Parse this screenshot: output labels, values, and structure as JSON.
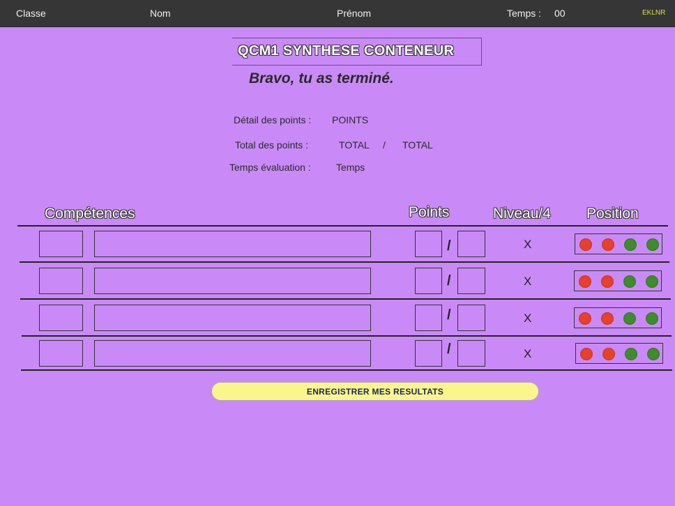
{
  "topbar": {
    "classe_label": "Classe",
    "nom_label": "Nom",
    "prenom_label": "Prénom",
    "temps_label": "Temps :",
    "temps_value": "00",
    "brand": "EKLNR"
  },
  "header": {
    "title": "QCM1 SYNTHESE CONTENEUR",
    "message": "Bravo, tu as terminé."
  },
  "summary": {
    "detail_label": "Détail des points :",
    "detail_value": "POINTS",
    "total_label": "Total des points :",
    "total_value": "TOTAL",
    "total_separator": "/",
    "total_max": "TOTAL",
    "time_label": "Temps évaluation :",
    "time_value": "Temps"
  },
  "table": {
    "headers": {
      "competences": "Compétences",
      "points": "Points",
      "niveau": "Niveau/4",
      "position": "Position"
    },
    "rows": [
      {
        "code": "",
        "competence": "",
        "points": "",
        "max": "",
        "separator": "/",
        "niveau": "X"
      },
      {
        "code": "",
        "competence": "",
        "points": "",
        "max": "",
        "separator": "/",
        "niveau": "X"
      },
      {
        "code": "",
        "competence": "",
        "points": "",
        "max": "",
        "separator": "/",
        "niveau": "X"
      },
      {
        "code": "",
        "competence": "",
        "points": "",
        "max": "",
        "separator": "/",
        "niveau": "X"
      }
    ],
    "position_colors": [
      "#e8412a",
      "#e8412a",
      "#3f8c2a",
      "#3f8c2a"
    ]
  },
  "actions": {
    "save_label": "ENREGISTRER MES RESULTATS"
  },
  "colors": {
    "background": "#c98af7",
    "topbar": "#363636",
    "button": "#faf68c"
  }
}
